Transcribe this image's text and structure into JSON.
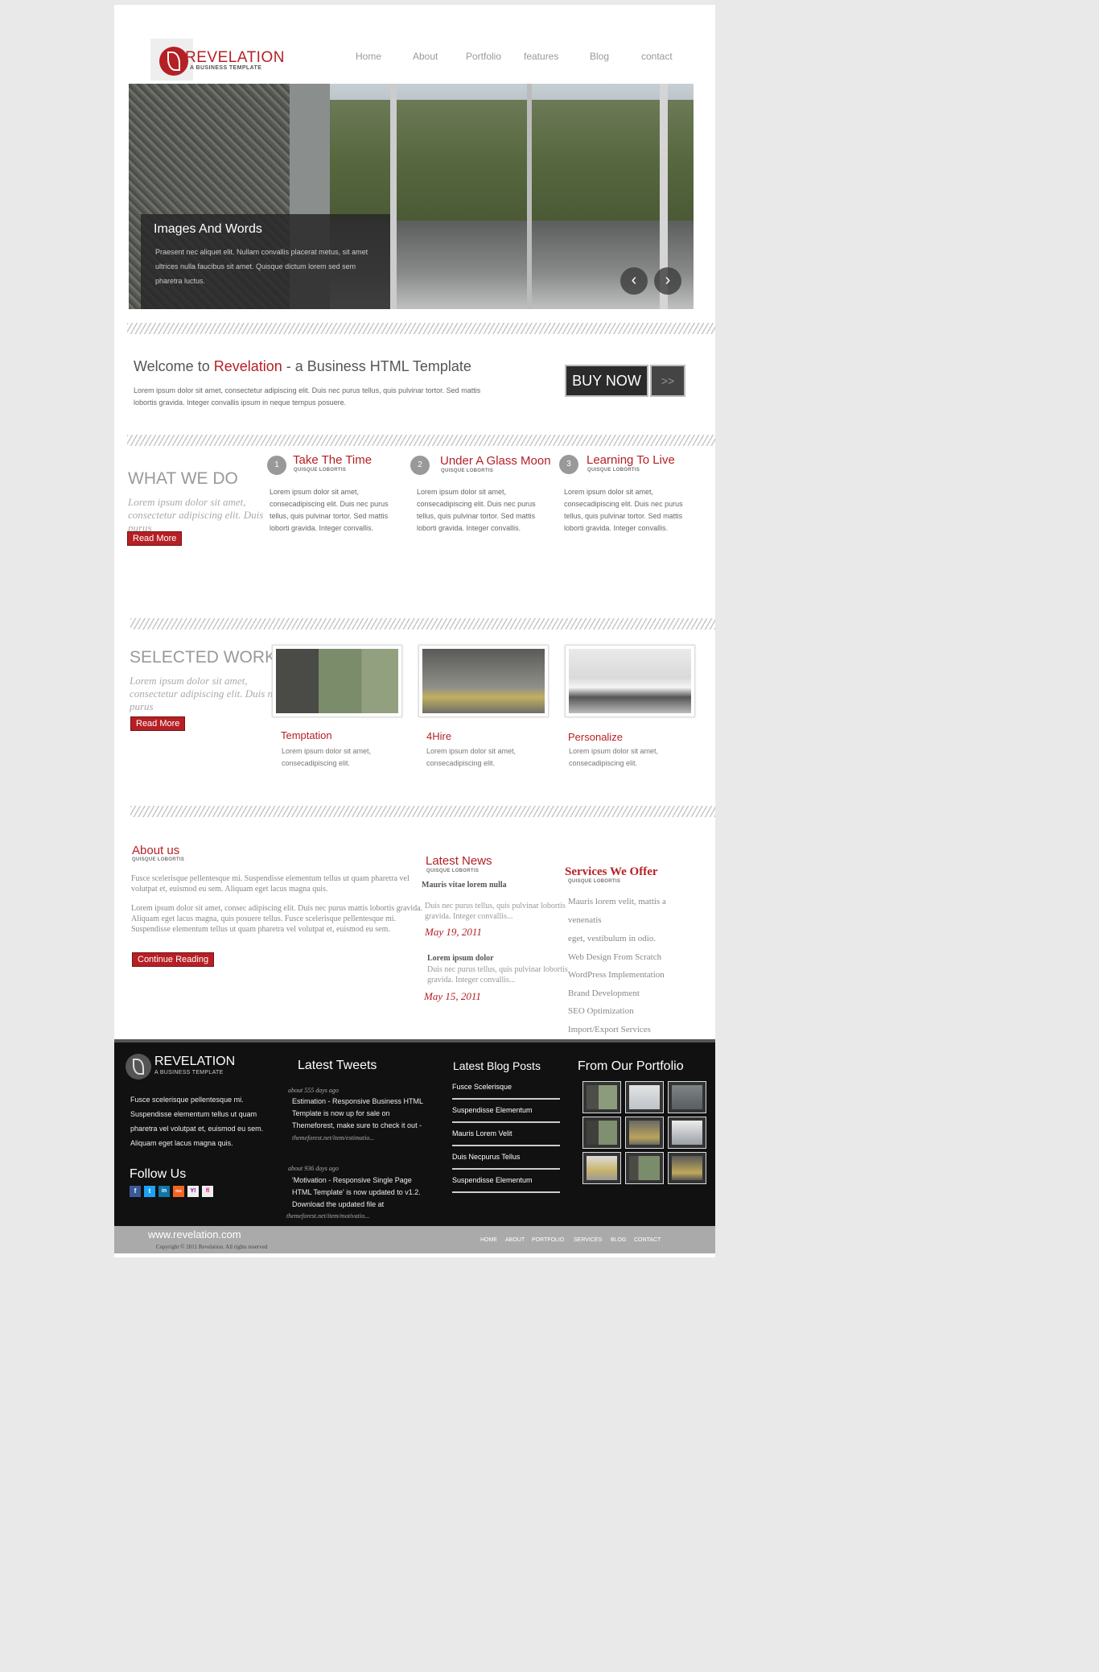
{
  "logo": {
    "name": "REVELATION",
    "tagline": "A BUSINESS TEMPLATE"
  },
  "nav": [
    "Home",
    "About",
    "Portfolio",
    "features",
    "Blog",
    "contact"
  ],
  "hero": {
    "caption_title": "Images And Words",
    "caption_text": "Praesent nec aliquet elit. Nullam convallis placerat metus, sit amet ultrices nulla faucibus sit amet. Quisque dictum lorem sed sem pharetra luctus.",
    "prev_icon": "chevron-left-icon",
    "next_icon": "chevron-right-icon"
  },
  "welcome": {
    "prefix": "Welcome to ",
    "highlight": "Revelation",
    "suffix": " - a Business HTML Template",
    "text": "Lorem ipsum dolor sit amet, consectetur adipiscing elit. Duis nec purus tellus, quis pulvinar tortor. Sed mattis lobortis gravida. Integer convallis ipsum in neque tempus posuere.",
    "buy_label": "BUY NOW",
    "buy_arrow": ">>"
  },
  "what_we_do": {
    "title": "WHAT WE DO",
    "intro": "Lorem ipsum dolor sit amet, consectetur adipiscing elit. Duis nec purus",
    "read_more": "Read More",
    "items": [
      {
        "num": "1",
        "title": "Take The Time",
        "sub": "QUISQUE LOBORTIS",
        "text": "Lorem ipsum dolor sit amet, consecadipiscing elit. Duis nec purus tellus, quis pulvinar tortor. Sed mattis loborti gravida. Integer convallis."
      },
      {
        "num": "2",
        "title": "Under A Glass Moon",
        "sub": "QUISQUE LOBORTIS",
        "text": "Lorem ipsum dolor sit amet, consecadipiscing elit. Duis nec purus tellus, quis pulvinar tortor. Sed mattis loborti gravida. Integer convallis."
      },
      {
        "num": "3",
        "title": "Learning To Live",
        "sub": "QUISQUE LOBORTIS",
        "text": "Lorem ipsum dolor sit amet, consecadipiscing elit. Duis nec purus tellus, quis pulvinar tortor. Sed mattis loborti gravida. Integer convallis."
      }
    ]
  },
  "selected_work": {
    "title": "SELECTED WORK",
    "intro": "Lorem ipsum dolor sit amet, consectetur adipiscing elit. Duis nec purus",
    "read_more": "Read More",
    "items": [
      {
        "title": "Temptation",
        "text": "Lorem ipsum dolor sit amet, consecadipiscing elit."
      },
      {
        "title": "4Hire",
        "text": "Lorem ipsum dolor sit amet, consecadipiscing elit."
      },
      {
        "title": "Personalize",
        "text": "Lorem ipsum dolor sit amet, consecadipiscing elit."
      }
    ]
  },
  "about": {
    "title": "About us",
    "sub": "QUISQUE LOBORTIS",
    "p1": "Fusce scelerisque pellentesque mi. Suspendisse elementum tellus ut quam pharetra vel volutpat et, euismod eu sem. Aliquam eget lacus magna quis.",
    "p2": "Lorem ipsum dolor sit amet, consec adipiscing elit. Duis nec purus mattis lobortis gravida. Aliquam eget lacus magna, quis posuere tellus. Fusce scelerisque pellentesque mi. Suspendisse elementum tellus ut quam pharetra vel volutpat et, euismod eu sem.",
    "button": "Continue Reading"
  },
  "news": {
    "title": "Latest News",
    "sub": "QUISQUE LOBORTIS",
    "items": [
      {
        "head": "Mauris vitae lorem nulla",
        "body": "Duis nec purus tellus, quis pulvinar lobortis gravida. Integer convallis...",
        "date": "May 19, 2011"
      },
      {
        "head": "Lorem ipsum dolor",
        "body": "Duis nec purus tellus, quis pulvinar lobortis gravida. Integer convallis...",
        "date": "May 15, 2011"
      }
    ]
  },
  "services": {
    "title": "Services We Offer",
    "sub": "QUISQUE LOBORTIS",
    "items": [
      "Mauris lorem velit, mattis a",
      "venenatis",
      "eget, vestibulum in odio.",
      "Web Design From Scratch",
      "WordPress Implementation",
      "Brand Development",
      "SEO Optimization",
      "Import/Export Services"
    ]
  },
  "footer": {
    "logo_name": "REVELATION",
    "logo_tag": "A BUSINESS TEMPLATE",
    "text": "Fusce scelerisque pellentesque mi. Suspendisse elementum tellus ut quam pharetra vel volutpat et, euismod eu sem. Aliquam eget lacus magna quis.",
    "follow_title": "Follow Us",
    "social": [
      "f",
      "t",
      "in",
      "rss",
      "Y!",
      "fl"
    ],
    "tweets_title": "Latest Tweets",
    "tweets": [
      {
        "meta": "about 555 days ago",
        "text": "Estimation - Responsive Business HTML Template is now up for sale on Themeforest, make sure to check it out -",
        "link": "themeforest.net/item/estimatio..."
      },
      {
        "meta": "about 936 days ago",
        "text": "'Motivation - Responsive Single Page HTML Template' is now updated to v1.2. Download the updated file at",
        "link": "themeforest.net/item/motivatio..."
      }
    ],
    "blog_title": "Latest Blog Posts",
    "blog": [
      "Fusce Scelerisque",
      "Suspendisse Elementum",
      "Mauris Lorem Velit",
      "Duis Necpurus Tellus",
      "Suspendisse Elementum"
    ],
    "portfolio_title": "From Our Portfolio"
  },
  "bottom": {
    "url": "www.revelation.com",
    "copyright": "Copyright © 2011 Revelation. All rights reserved",
    "nav": [
      "HOME",
      "ABOUT",
      "PORTFOLIO",
      "SERVICES",
      "BLOG",
      "CONTACT"
    ]
  }
}
